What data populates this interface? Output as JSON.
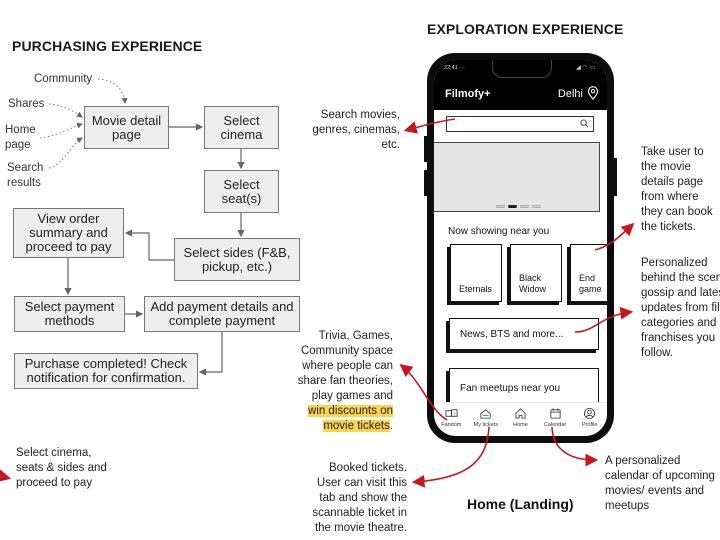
{
  "purchasing": {
    "title": "PURCHASING EXPERIENCE",
    "entry_points": [
      "Community",
      "Shares",
      "Home page",
      "Search results"
    ],
    "steps": {
      "movie_detail": "Movie detail page",
      "select_cinema": "Select cinema",
      "select_seats": "Select seat(s)",
      "select_sides": "Select sides (F&B, pickup, etc.)",
      "view_order": "View order summary and proceed to pay",
      "select_payment": "Select payment methods",
      "add_payment": "Add payment details and complete payment",
      "purchase_completed": "Purchase completed! Check notification for confirmation."
    }
  },
  "exploration": {
    "title": "EXPLORATION EXPERIENCE",
    "caption": "Home (Landing)",
    "phone": {
      "status_time": "22:41",
      "status_dots": "···",
      "status_icons": "◢ ◠ ▭",
      "app_name": "Filmofy+",
      "city": "Delhi",
      "search_placeholder": "",
      "banner_page": 2,
      "banner_pages_total": 4,
      "now_showing_title": "Now showing near you",
      "movies": [
        "Eternals",
        "Black Widow",
        "End game"
      ],
      "news_card": "News, BTS and more...",
      "meetups_card": "Fan meetups near you",
      "tabs": [
        "Fandom",
        "My tickets",
        "Home",
        "Calendar",
        "Profile"
      ]
    },
    "annotations": {
      "search": "Search movies, genres, cinemas, etc.",
      "movie_card": "Take user to the movie details page from where they can book the tickets.",
      "news": "Personalized behind the scenes gossip and latest updates from film categories and franchises you follow.",
      "fandom_plain": "Trivia, Games, Community space where people can share fan theories, play games and",
      "fandom_highlight": "win discounts on movie tickets",
      "fandom_end": ".",
      "tickets": "Booked tickets. User can visit this tab and show the scannable ticket in the movie theatre.",
      "calendar": "A personalized calendar of upcoming movies/ events and meetups",
      "bottom_left": "Select cinema, seats & sides and proceed to pay"
    }
  },
  "colors": {
    "arrow_red": "#c8161d",
    "highlight": "#fcd34d",
    "box_fill": "#eeeeee"
  }
}
